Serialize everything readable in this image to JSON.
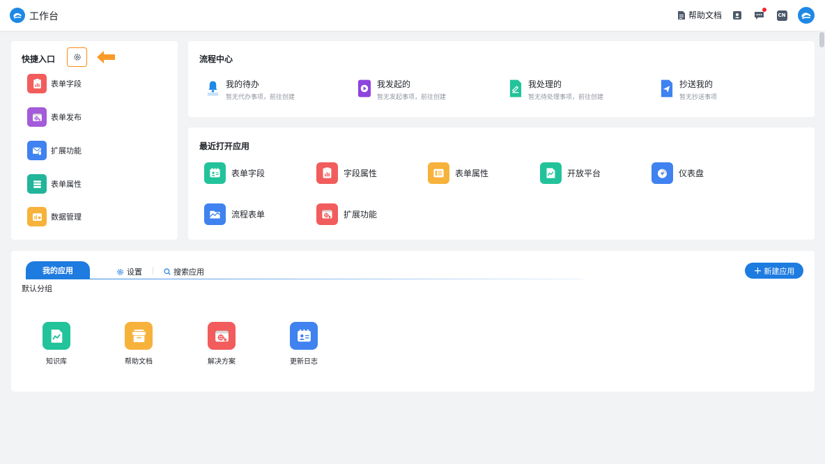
{
  "header": {
    "title": "工作台",
    "help_doc": "帮助文档",
    "lang": "CN"
  },
  "quick_entry": {
    "title": "快捷入口",
    "items": [
      {
        "label": "表单字段",
        "icon": "chart-clipboard-icon",
        "color": "#f25c5c"
      },
      {
        "label": "表单发布",
        "icon": "browser-target-icon",
        "color": "#a35bd9"
      },
      {
        "label": "扩展功能",
        "icon": "mail-attach-icon",
        "color": "#3f82f0"
      },
      {
        "label": "表单属性",
        "icon": "list-rows-icon",
        "color": "#22b59a"
      },
      {
        "label": "数据管理",
        "icon": "dashboard-icon",
        "color": "#f7b23b"
      }
    ]
  },
  "process_center": {
    "title": "流程中心",
    "items": [
      {
        "title": "我的待办",
        "subtitle": "暂无代办事项，前往创建",
        "icon": "bell-icon",
        "color": "#1e88e5"
      },
      {
        "title": "我发起的",
        "subtitle": "暂无发起事项，前往创建",
        "icon": "play-icon",
        "color": "#8e44dd"
      },
      {
        "title": "我处理的",
        "subtitle": "暂无待处理事项，前往创建",
        "icon": "edit-doc-icon",
        "color": "#22c39a"
      },
      {
        "title": "抄送我的",
        "subtitle": "暂无抄送事项",
        "icon": "send-icon",
        "color": "#3f82f0"
      }
    ]
  },
  "recent_apps": {
    "title": "最近打开应用",
    "items": [
      {
        "label": "表单字段",
        "icon": "id-card-icon",
        "color": "#22c39a"
      },
      {
        "label": "字段属性",
        "icon": "chart-clipboard-icon",
        "color": "#f25c5c"
      },
      {
        "label": "表单属性",
        "icon": "form-icon",
        "color": "#f7b23b"
      },
      {
        "label": "开放平台",
        "icon": "trend-doc-icon",
        "color": "#22c39a"
      },
      {
        "label": "仪表盘",
        "icon": "yen-pie-icon",
        "color": "#3f82f0"
      },
      {
        "label": "流程表单",
        "icon": "folder-icon",
        "color": "#3f82f0"
      },
      {
        "label": "扩展功能",
        "icon": "browser-target-icon",
        "color": "#f25c5c"
      }
    ]
  },
  "my_apps": {
    "tab_active": "我的应用",
    "settings": "设置",
    "search": "搜索应用",
    "new_app": "新建应用",
    "group": "默认分组",
    "items": [
      {
        "label": "知识库",
        "icon": "trend-doc-icon",
        "color": "#22c39a"
      },
      {
        "label": "帮助文档",
        "icon": "box-icon",
        "color": "#f7b23b"
      },
      {
        "label": "解决方案",
        "icon": "browser-target-icon",
        "color": "#f25c5c"
      },
      {
        "label": "更新日志",
        "icon": "id-card-icon",
        "color": "#3f82f0"
      }
    ]
  },
  "colors": {
    "primary": "#1e7be0",
    "accent_orange": "#fa8c16"
  }
}
